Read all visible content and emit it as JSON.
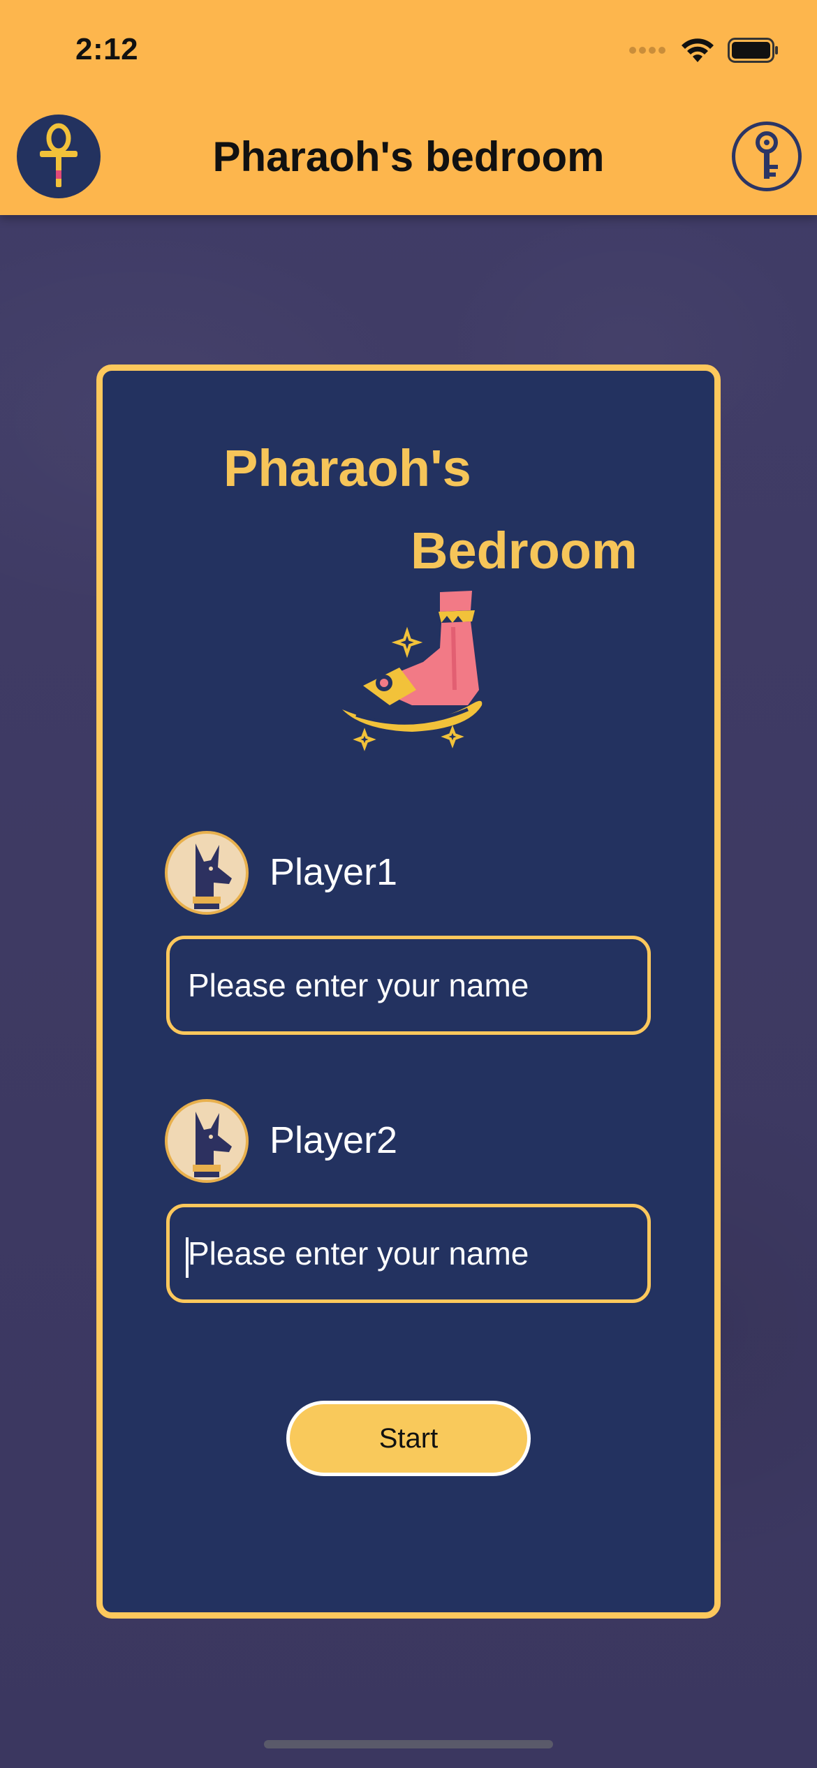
{
  "status_bar": {
    "time": "2:12"
  },
  "nav": {
    "title": "Pharaoh's bedroom",
    "left_icon": "ankh-icon",
    "right_icon": "key-icon"
  },
  "card": {
    "logo_line1": "Pharaoh's",
    "logo_line2": "Bedroom",
    "players": [
      {
        "label": "Player1",
        "placeholder": "Please enter your name",
        "value": ""
      },
      {
        "label": "Player2",
        "placeholder": "Please enter your name",
        "value": ""
      }
    ],
    "start_label": "Start"
  },
  "colors": {
    "header": "#fdb64d",
    "background": "#3f3b65",
    "card": "#233260",
    "accent": "#fdc85c"
  }
}
